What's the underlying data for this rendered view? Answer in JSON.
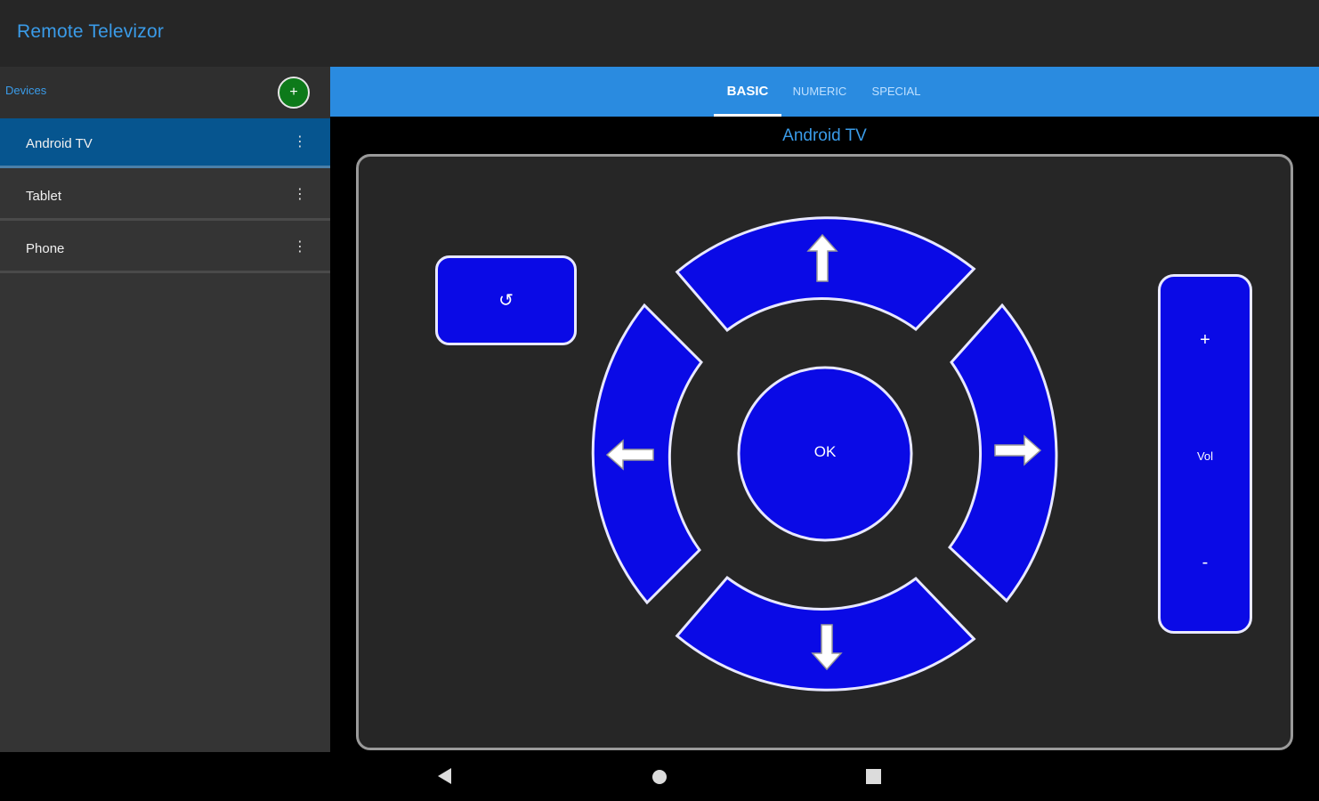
{
  "app": {
    "title": "Remote Televizor"
  },
  "sidebar": {
    "header_label": "Devices",
    "add_label": "+",
    "items": [
      {
        "label": "Android TV",
        "selected": true,
        "menu": "⋮"
      },
      {
        "label": "Tablet",
        "selected": false,
        "menu": "⋮"
      },
      {
        "label": "Phone",
        "selected": false,
        "menu": "⋮"
      }
    ]
  },
  "tabs": [
    {
      "label": "BASIC",
      "active": true
    },
    {
      "label": "NUMERIC",
      "active": false
    },
    {
      "label": "SPECIAL",
      "active": false
    }
  ],
  "remote": {
    "device_name": "Android TV",
    "back_symbol": "↺",
    "ok_label": "OK",
    "volume": {
      "plus": "+",
      "label": "Vol",
      "minus": "-"
    }
  },
  "icons": {
    "back": "back-icon",
    "up": "arrow-up-icon",
    "down": "arrow-down-icon",
    "left": "arrow-left-icon",
    "right": "arrow-right-icon",
    "nav_back": "nav-back-icon",
    "nav_home": "nav-home-icon",
    "nav_recents": "nav-recents-icon"
  },
  "colors": {
    "accent": "#2a8be0",
    "button_fill": "#0a0ae6",
    "selected_row": "#06558f",
    "add_button": "#0d7a1a"
  }
}
